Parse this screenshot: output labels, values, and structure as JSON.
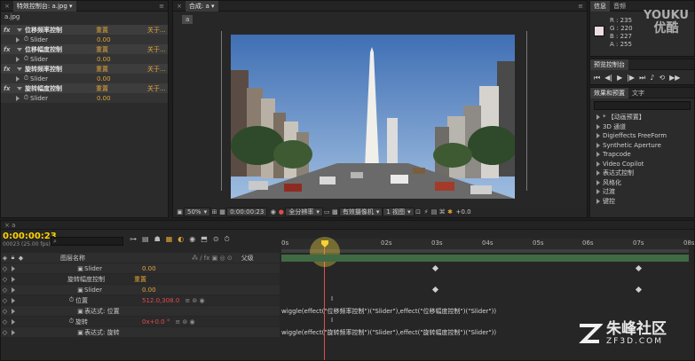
{
  "effects_panel": {
    "tab_label": "特效控制台: a.jpg",
    "layer_label": "a.jpg",
    "rows": [
      {
        "fx": "fx",
        "name": "位移频率控制",
        "reset": "重置",
        "about": "关于..."
      },
      {
        "fx": "",
        "name": "Slider",
        "value": "0.00"
      },
      {
        "fx": "fx",
        "name": "位移幅度控制",
        "reset": "重置",
        "about": "关于..."
      },
      {
        "fx": "",
        "name": "Slider",
        "value": "0.00"
      },
      {
        "fx": "fx",
        "name": "旋转频率控制",
        "reset": "重置",
        "about": "关于..."
      },
      {
        "fx": "",
        "name": "Slider",
        "value": "0.00"
      },
      {
        "fx": "fx",
        "name": "旋转幅度控制",
        "reset": "重置",
        "about": "关于..."
      },
      {
        "fx": "",
        "name": "Slider",
        "value": "0.00"
      }
    ]
  },
  "comp_panel": {
    "tab_label": "合成: a",
    "comp_chip": "a",
    "zoom": "50%",
    "timecode": "0:00:00:23",
    "resolution": "全分辨率",
    "view_mode": "有效摄像机",
    "views": "1 视图",
    "exposure": "+0.0"
  },
  "info_panel": {
    "tab_info": "信息",
    "tab_audio": "音频",
    "r": "R : 235",
    "g": "G : 220",
    "b": "B : 227",
    "a": "A : 255",
    "swatch_color": "#ecdce3"
  },
  "preview_panel": {
    "tab_label": "预览控制台"
  },
  "effects_presets": {
    "tab_label": "效果和预置",
    "tab_text": "文字",
    "items": [
      "* 【动画预置】",
      "3D 通道",
      "Digieffects FreeForm",
      "Synthetic Aperture",
      "Trapcode",
      "Video Copilot",
      "表达式控制",
      "风格化",
      "过渡",
      "键控"
    ]
  },
  "timeline": {
    "timecode": "0:00:00:23",
    "fps": "00023 (25.00 fps)",
    "search_placeholder": "",
    "column_source": "图层名称",
    "column_parent": "父级",
    "ruler": [
      "0s",
      "02s",
      "03s",
      "04s",
      "05s",
      "06s",
      "07s",
      "08s"
    ],
    "layers": [
      {
        "indent": 1,
        "name": "Slider",
        "value": "0.00",
        "value_color": "orange"
      },
      {
        "indent": 0,
        "name": "旋转幅度控制",
        "value": "重置",
        "value_color": "orange"
      },
      {
        "indent": 1,
        "name": "Slider",
        "value": "0.00",
        "value_color": "orange"
      },
      {
        "indent": 0,
        "name": "位置",
        "value": "512.0,308.0",
        "value_color": "red"
      },
      {
        "indent": 1,
        "name": "表达式: 位置",
        "value": "",
        "value_color": "orange"
      },
      {
        "indent": 0,
        "name": "旋转",
        "value": "0x+0.0 °",
        "value_color": "red"
      },
      {
        "indent": 1,
        "name": "表达式: 旋转",
        "value": "",
        "value_color": "orange"
      }
    ],
    "expr_position": "wiggle(effect(\"位移频率控制\")(\"Slider\"),effect(\"位移幅度控制\")(\"Slider\"))",
    "expr_rotation": "wiggle(effect(\"旋转频率控制\")(\"Slider\"),effect(\"旋转幅度控制\")(\"Slider\"))"
  },
  "watermark": {
    "brand": "YOUKU",
    "brand2": "优酷",
    "site": "朱峰社区",
    "site_url": "ZF3D.COM"
  }
}
